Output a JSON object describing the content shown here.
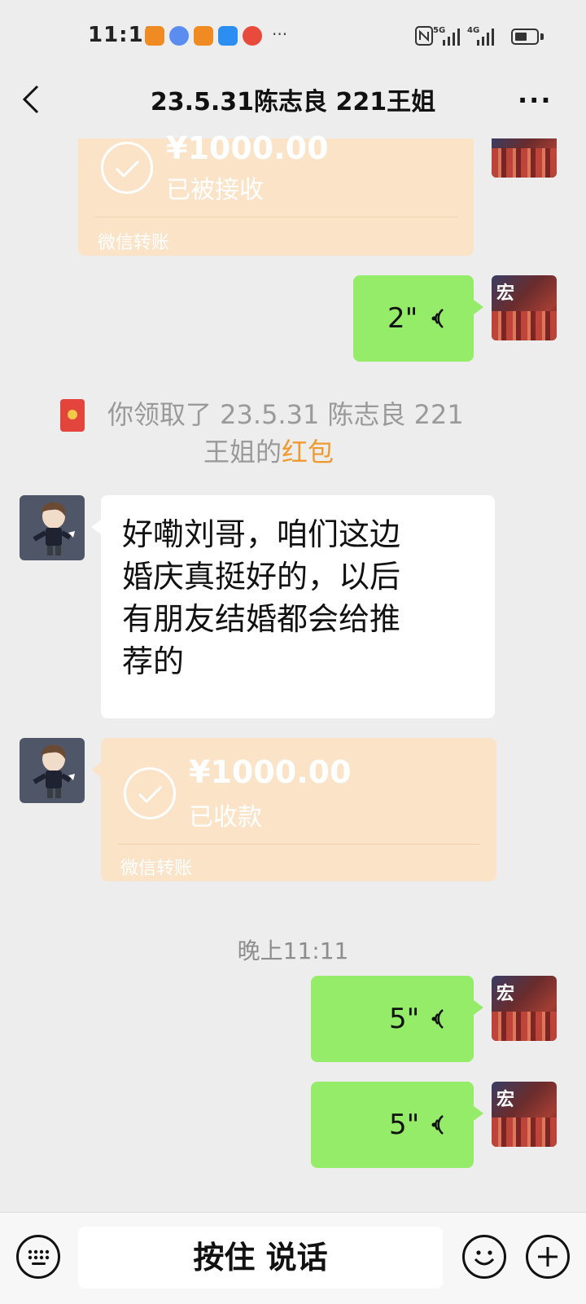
{
  "status_bar": {
    "time": "11:11",
    "more_indicator": "···",
    "network_1": "5G",
    "network_2": "4G",
    "battery_percent": 60
  },
  "header": {
    "title": "23.5.31陈志良 221王姐",
    "back_icon": "chevron-left-icon",
    "more_label": "···"
  },
  "messages": [
    {
      "type": "transfer",
      "side": "right",
      "amount": "¥1000.00",
      "status": "已被接收",
      "label": "微信转账"
    },
    {
      "type": "voice",
      "side": "right",
      "duration": "2\""
    },
    {
      "type": "system",
      "text_prefix": "你领取了 23.5.31 陈志良 221",
      "text_line2_prefix": "王姐的",
      "highlight": "红包"
    },
    {
      "type": "text",
      "side": "left",
      "lines": [
        "好嘞刘哥，咱们这边",
        "婚庆真挺好的，以后",
        "有朋友结婚都会给推",
        "荐的"
      ]
    },
    {
      "type": "transfer",
      "side": "left",
      "amount": "¥1000.00",
      "status": "已收款",
      "label": "微信转账"
    },
    {
      "type": "timestamp",
      "text": "晚上11:11"
    },
    {
      "type": "voice",
      "side": "right",
      "duration": "5\""
    },
    {
      "type": "voice",
      "side": "right",
      "duration": "5\""
    }
  ],
  "self_avatar_sign": "宏",
  "bottom_bar": {
    "hold_to_talk": "按住 说话",
    "keyboard_icon": "keyboard-icon",
    "emoji_icon": "emoji-icon",
    "plus_icon": "plus-icon"
  },
  "colors": {
    "background": "#ededed",
    "self_bubble": "#95ec69",
    "transfer_bubble": "#fbe3c8",
    "red_packet_link": "#f09a2e"
  }
}
